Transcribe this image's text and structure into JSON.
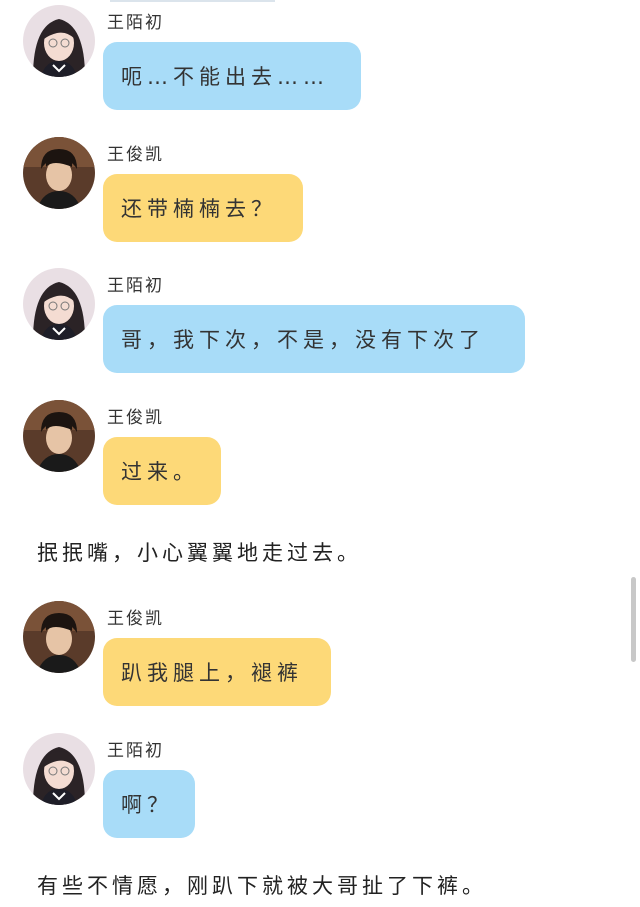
{
  "characters": {
    "female": {
      "name": "王陌初",
      "bubble_color": "#a8dcf8",
      "avatar_icon": "girl-avatar-icon"
    },
    "male": {
      "name": "王俊凯",
      "bubble_color": "#fdd978",
      "avatar_icon": "boy-avatar-icon"
    }
  },
  "messages": [
    {
      "name": "王陌初",
      "text": "呃…不能出去……"
    },
    {
      "name": "王俊凯",
      "text": "还带楠楠去？"
    },
    {
      "name": "王陌初",
      "text": "哥，我下次，不是，没有下次了"
    },
    {
      "name": "王俊凯",
      "text": "过来。"
    },
    {
      "narration": "抿抿嘴，小心翼翼地走过去。"
    },
    {
      "name": "王俊凯",
      "text": "趴我腿上，褪裤"
    },
    {
      "name": "王陌初",
      "text": "啊？"
    },
    {
      "narration": "有些不情愿，刚趴下就被大哥扯了下裤。"
    }
  ]
}
